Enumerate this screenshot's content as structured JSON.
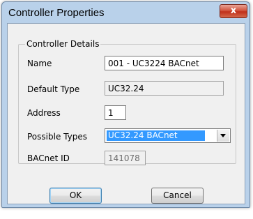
{
  "window": {
    "title": "Controller Properties"
  },
  "group": {
    "title": "Controller Details"
  },
  "fields": {
    "name": {
      "label": "Name",
      "value": "001 - UC3224 BACnet"
    },
    "default_type": {
      "label": "Default Type",
      "value": "UC32.24"
    },
    "address": {
      "label": "Address",
      "value": "1"
    },
    "possible_types": {
      "label": "Possible Types",
      "value": "UC32.24 BACnet"
    },
    "bacnet_id": {
      "label": "BACnet ID",
      "value": "141078"
    }
  },
  "buttons": {
    "ok": "OK",
    "cancel": "Cancel",
    "close": "x"
  },
  "colors": {
    "selection": "#3399ff",
    "frame": "#b9d1ea",
    "dialog": "#f0f0f0"
  }
}
